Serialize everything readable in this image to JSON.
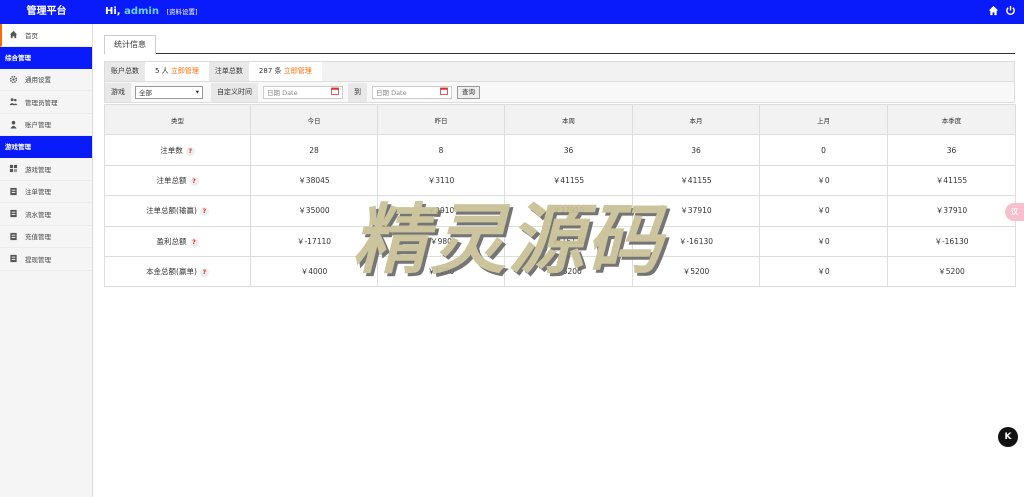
{
  "header": {
    "brand": "管理平台",
    "greeting": "Hi,",
    "username": "admin",
    "profile_link": "[资料设置]",
    "home_icon": "home-icon",
    "power_icon": "power-icon"
  },
  "sidebar": {
    "home": "首页",
    "group1": "综合管理",
    "group1_items": [
      "通用设置",
      "管理员管理",
      "账户管理"
    ],
    "group2": "游戏管理",
    "group2_items": [
      "游戏管理",
      "注单管理",
      "流水管理",
      "充值管理",
      "提现管理"
    ]
  },
  "tab": {
    "label": "统计信息"
  },
  "summary": {
    "account_label": "账户总数",
    "account_count": "5 人",
    "account_link": "立即管理",
    "order_label": "注单总数",
    "order_count": "287 条",
    "order_link": "立即管理"
  },
  "filter": {
    "game_label": "游戏",
    "game_value": "全部",
    "custom_time_label": "自定义时间",
    "date_placeholder_start": "日期 Date",
    "to_label": "到",
    "date_placeholder_end": "日期 Date",
    "query_button": "查询"
  },
  "table": {
    "headers": [
      "类型",
      "今日",
      "昨日",
      "本周",
      "本月",
      "上月",
      "本季度"
    ],
    "rows": [
      {
        "label": "注单数",
        "values": [
          "28",
          "8",
          "36",
          "36",
          "0",
          "36"
        ]
      },
      {
        "label": "注单总额",
        "values": [
          "￥38045",
          "￥3110",
          "￥41155",
          "￥41155",
          "￥0",
          "￥41155"
        ]
      },
      {
        "label": "注单总额(输赢)",
        "values": [
          "￥35000",
          "￥2910",
          "￥37910",
          "￥37910",
          "￥0",
          "￥37910"
        ]
      },
      {
        "label": "盈利总额",
        "values": [
          "￥-17110",
          "￥980",
          "￥-16130",
          "￥-16130",
          "￥0",
          "￥-16130"
        ]
      },
      {
        "label": "本金总额(赢单)",
        "values": [
          "￥4000",
          "￥1200",
          "￥5200",
          "￥5200",
          "￥0",
          "￥5200"
        ]
      }
    ],
    "help_mark": "?"
  },
  "watermark": "精灵源码",
  "float_tag": "汉",
  "fab": "K"
}
